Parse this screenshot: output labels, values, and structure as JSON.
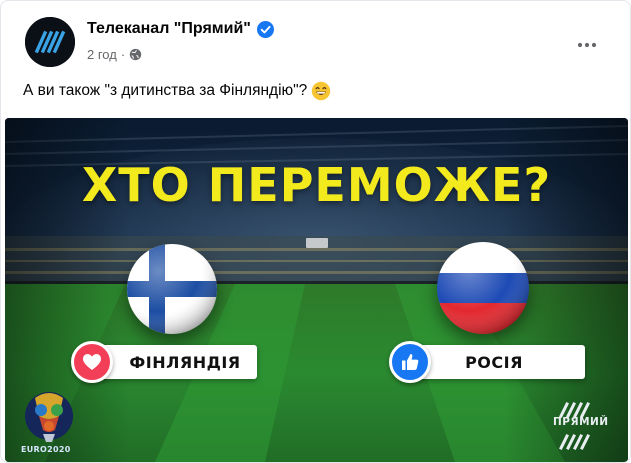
{
  "post": {
    "page_name": "Телеканал \"Прямий\"",
    "timestamp": "2 год",
    "separator": "·",
    "text": "А ви також \"з дитинства за Фінляндію\"?",
    "emoji": "grinning-smiling-eyes-emoji"
  },
  "image": {
    "headline": "ХТО ПЕРЕМОЖЕ?",
    "left_option": {
      "label": "ФІНЛЯНДІЯ",
      "reaction": "heart-icon",
      "color": "#f33e58"
    },
    "right_option": {
      "label": "РОСІЯ",
      "reaction": "like-icon",
      "color": "#1877f2"
    },
    "left_logo_text": "EURO2020",
    "right_logo_text": "ПРЯМИЙ",
    "headline_color": "#f2ea1d"
  },
  "colors": {
    "verified": "#1877f2",
    "secondary_text": "#65676b"
  }
}
